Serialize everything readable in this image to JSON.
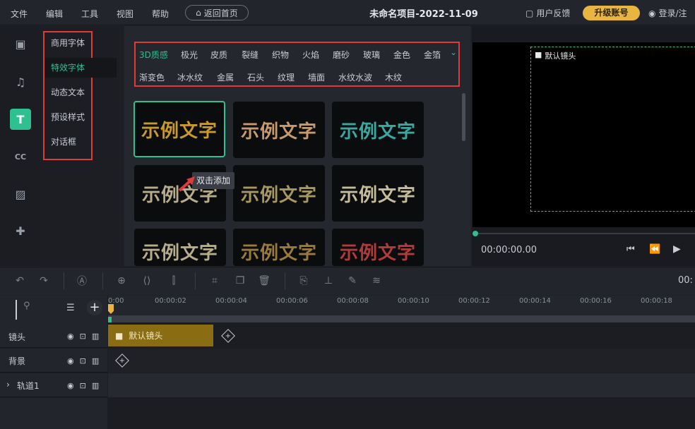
{
  "menu": {
    "items": [
      "文件",
      "编辑",
      "工具",
      "视图",
      "帮助"
    ],
    "home": "返回首页"
  },
  "project_title": "未命名项目-2022-11-09",
  "feedback": "用户反馈",
  "upgrade": "升级账号",
  "login": "登录/注",
  "categories": [
    "商用字体",
    "特效字体",
    "动态文本",
    "预设样式",
    "对话框"
  ],
  "filters": {
    "row1": [
      "3D质感",
      "极光",
      "皮质",
      "裂缝",
      "织物",
      "火焰",
      "磨砂",
      "玻璃",
      "金色",
      "金箔"
    ],
    "row2": [
      "渐变色",
      "冰水纹",
      "金属",
      "石头",
      "纹理",
      "墙面",
      "水纹水波",
      "木纹"
    ]
  },
  "sample_text": "示例文字",
  "tooltip": "双击添加",
  "preview": {
    "label": "默认镜头",
    "time": "00:00:00.00"
  },
  "timeline": {
    "ticks": [
      "0:00",
      "00:00:02",
      "00:00:04",
      "00:00:06",
      "00:00:08",
      "00:00:10",
      "00:00:12",
      "00:00:14",
      "00:00:16",
      "00:00:18"
    ],
    "right_time": "00:"
  },
  "tracks": [
    {
      "name": "镜头"
    },
    {
      "name": "背景"
    },
    {
      "name": "轨道1"
    }
  ],
  "clip": {
    "label": "默认镜头"
  },
  "accent": "#2ec08e"
}
